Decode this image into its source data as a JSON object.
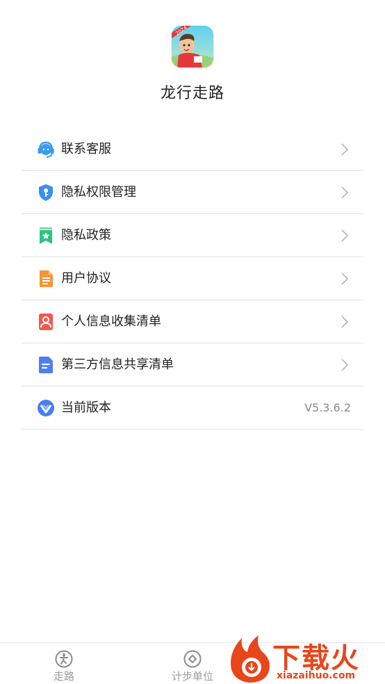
{
  "app": {
    "name": "龙行走路",
    "icon_badge": "2024"
  },
  "menu": {
    "items": [
      {
        "label": "联系客服",
        "icon": "headset-icon",
        "color": "#3a9bf0"
      },
      {
        "label": "隐私权限管理",
        "icon": "shield-key-icon",
        "color": "#3a8ff0"
      },
      {
        "label": "隐私政策",
        "icon": "bookmark-star-icon",
        "color": "#2ec27e"
      },
      {
        "label": "用户协议",
        "icon": "document-icon",
        "color": "#f5943b"
      },
      {
        "label": "个人信息收集清单",
        "icon": "person-card-icon",
        "color": "#f05a4b"
      },
      {
        "label": "第三方信息共享清单",
        "icon": "file-lines-icon",
        "color": "#4f7ef0"
      },
      {
        "label": "当前版本",
        "icon": "version-icon",
        "color": "#4a7df0",
        "value": "V5.3.6.2"
      }
    ]
  },
  "tabbar": {
    "tabs": [
      {
        "label": "走路",
        "icon": "walking-icon"
      },
      {
        "label": "计步单位",
        "icon": "diamond-circle-icon"
      }
    ]
  },
  "watermark": {
    "brand_cn": "下载火",
    "brand_en": "xiazaihuo.com"
  }
}
